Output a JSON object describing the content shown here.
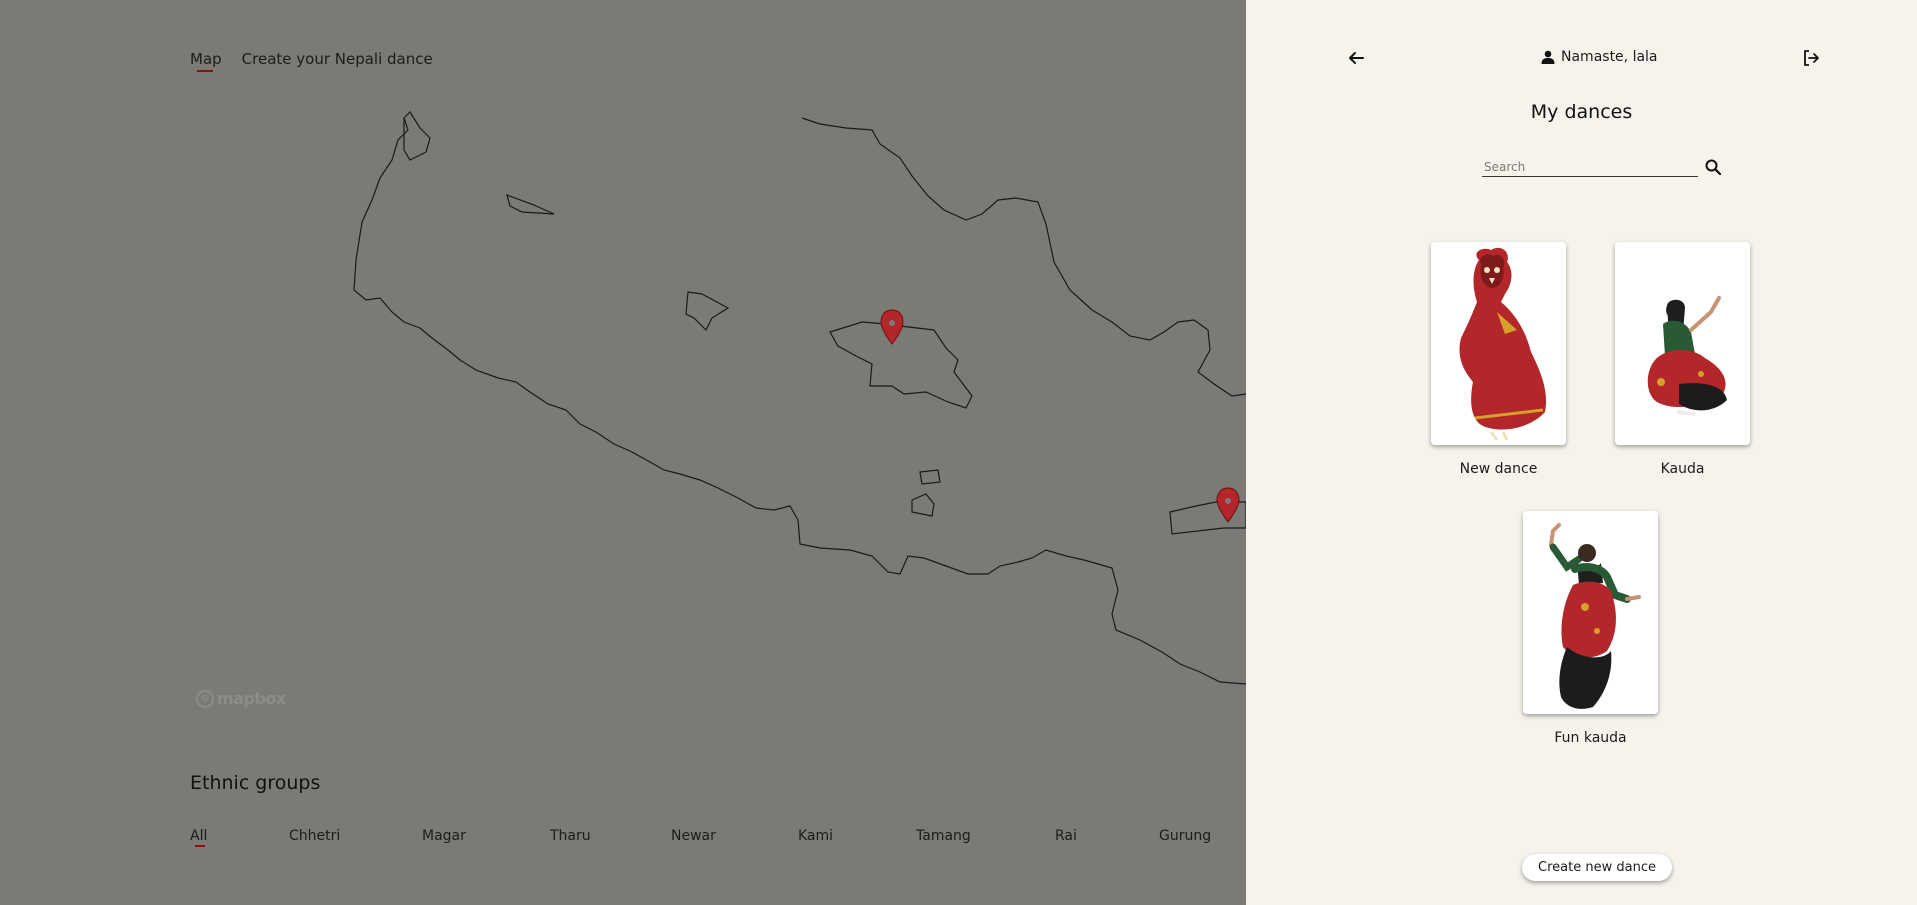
{
  "nav": {
    "map_label": "Map",
    "create_label": "Create your Nepali dance"
  },
  "map": {
    "attribution": "mapbox",
    "marker_color": "#b3262a",
    "outline_color": "#1a1a1a"
  },
  "ethnic": {
    "title": "Ethnic groups",
    "groups": [
      "All",
      "Chhetri",
      "Magar",
      "Tharu",
      "Newar",
      "Kami",
      "Tamang",
      "Rai",
      "Gurung"
    ]
  },
  "panel": {
    "greeting": "Namaste, lala",
    "title": "My dances",
    "search_placeholder": "Search",
    "dances": [
      {
        "name": "New dance",
        "image": "masked dancer in red costume"
      },
      {
        "name": "Kauda",
        "image": "kneeling dancer in red and green costume"
      },
      {
        "name": "Fun kauda",
        "image": "dancer with raised arms in red and green costume"
      }
    ],
    "create_button": "Create new dance"
  },
  "colors": {
    "panel_bg": "#f5f3ec",
    "overlay_bg": "#7b7a74",
    "accent": "#8a1111"
  }
}
